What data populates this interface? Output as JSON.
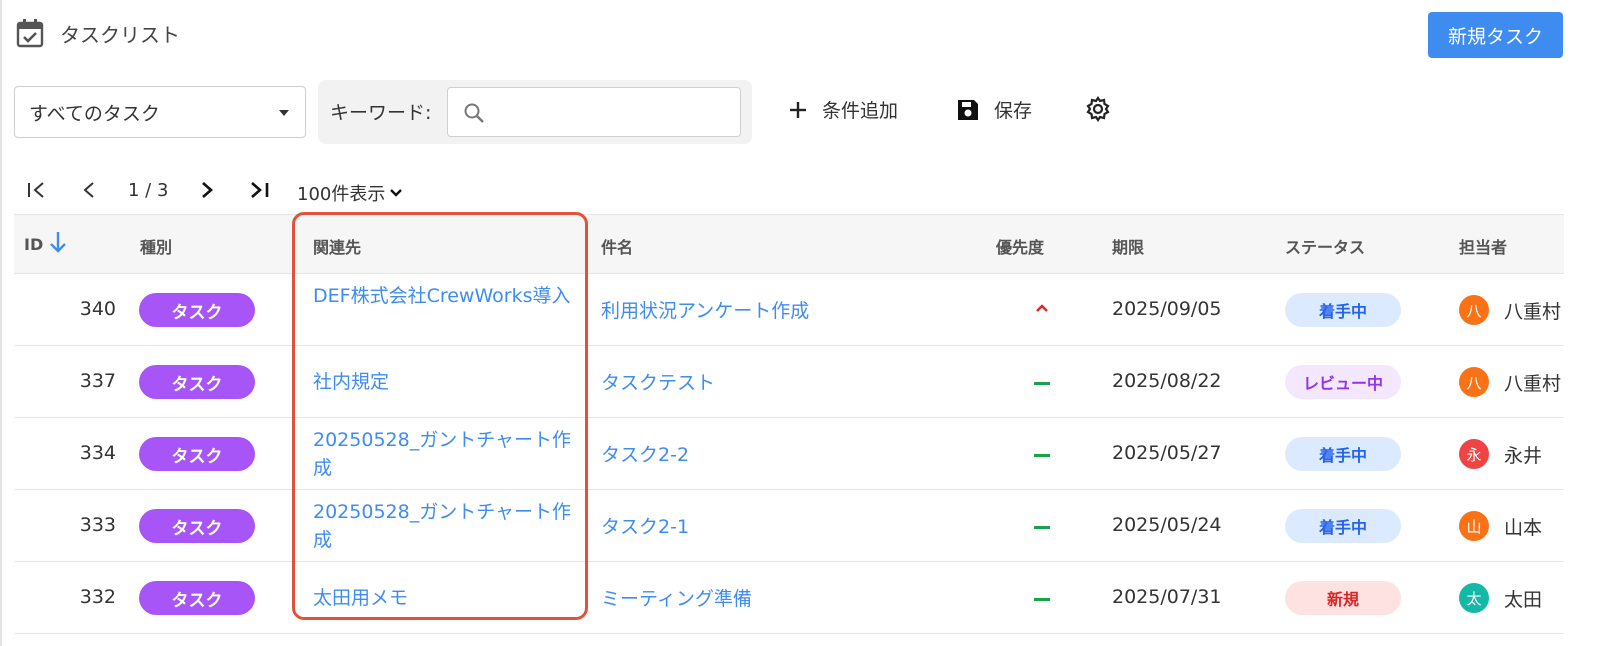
{
  "header": {
    "title": "タスクリスト",
    "new_task_label": "新規タスク"
  },
  "filter": {
    "view_select": "すべてのタスク",
    "keyword_label": "キーワード:",
    "keyword_value": "",
    "add_condition_label": "条件追加",
    "save_label": "保存"
  },
  "pagination": {
    "page_text": "1 / 3",
    "per_page": "100件表示"
  },
  "columns": {
    "id": "ID",
    "type": "種別",
    "related": "関連先",
    "subject": "件名",
    "priority": "優先度",
    "due": "期限",
    "status": "ステータス",
    "assignee": "担当者"
  },
  "colors": {
    "accent": "#3f8cf0",
    "type_badge": "#a855f7",
    "priority_high": "#dc2626",
    "priority_normal": "#16a34a",
    "highlight": "#e0523b"
  },
  "rows": [
    {
      "id": "340",
      "type": "タスク",
      "related": "DEF株式会社CrewWorks導入",
      "subject": "利用状況アンケート作成",
      "priority": "high",
      "due": "2025/09/05",
      "status": "着手中",
      "assignee_initial": "八",
      "assignee": "八重村"
    },
    {
      "id": "337",
      "type": "タスク",
      "related": "社内規定",
      "subject": "タスクテスト",
      "priority": "normal",
      "due": "2025/08/22",
      "status": "レビュー中",
      "assignee_initial": "八",
      "assignee": "八重村"
    },
    {
      "id": "334",
      "type": "タスク",
      "related": "20250528_ガントチャート作成",
      "subject": "タスク2-2",
      "priority": "normal",
      "due": "2025/05/27",
      "status": "着手中",
      "assignee_initial": "永",
      "assignee": "永井"
    },
    {
      "id": "333",
      "type": "タスク",
      "related": "20250528_ガントチャート作成",
      "subject": "タスク2-1",
      "priority": "normal",
      "due": "2025/05/24",
      "status": "着手中",
      "assignee_initial": "山",
      "assignee": "山本"
    },
    {
      "id": "332",
      "type": "タスク",
      "related": "太田用メモ",
      "subject": "ミーティング準備",
      "priority": "normal",
      "due": "2025/07/31",
      "status": "新規",
      "assignee_initial": "太",
      "assignee": "太田"
    }
  ]
}
